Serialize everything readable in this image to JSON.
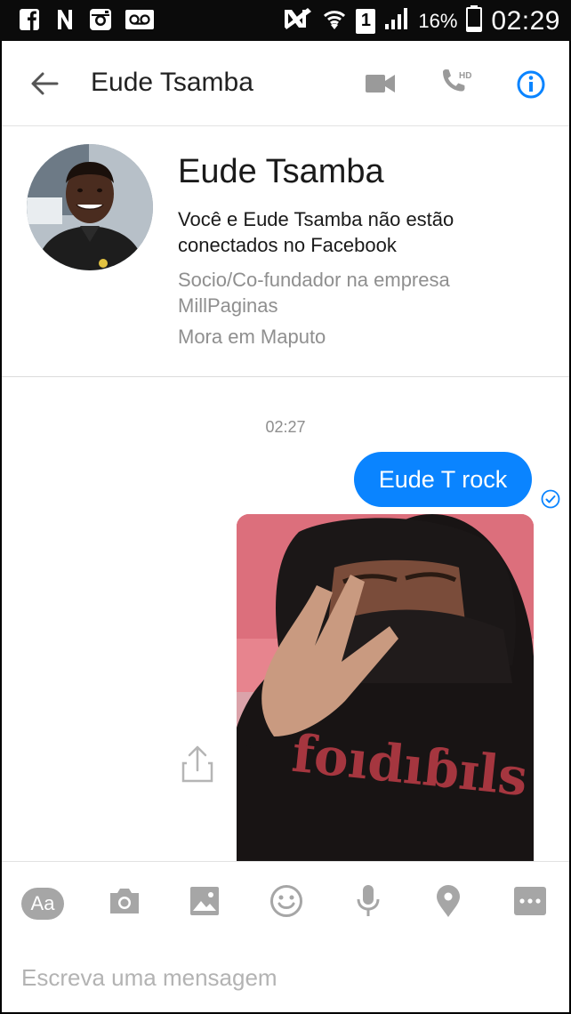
{
  "status_bar": {
    "icons_left": [
      "facebook-icon",
      "n-notification-icon",
      "instagram-icon",
      "voicemail-icon"
    ],
    "icons_right": [
      "nfc-icon",
      "wifi-icon",
      "sim-1-icon",
      "signal-icon",
      "battery-icon"
    ],
    "sim_label": "1",
    "battery_percent": "16%",
    "time": "02:29"
  },
  "toolbar": {
    "title": "Eude Tsamba",
    "call_hd_label": "HD",
    "accent_color": "#0a84ff"
  },
  "profile": {
    "name": "Eude Tsamba",
    "connection_note": "Você e Eude Tsamba não estão conectados no Facebook",
    "work": "Socio/Co-fundador na empresa MillPaginas",
    "location": "Mora em Maputo"
  },
  "conversation": {
    "timestamp": "02:27",
    "messages": [
      {
        "type": "text",
        "text": "Eude T rock",
        "sender": "me",
        "status": "seen"
      },
      {
        "type": "photo",
        "sender": "me"
      }
    ]
  },
  "composer": {
    "icons": [
      "text-style-icon",
      "camera-icon",
      "gallery-icon",
      "emoji-icon",
      "microphone-icon",
      "location-icon",
      "more-icon"
    ],
    "aa_label": "Aa",
    "placeholder": "Escreva uma mensagem"
  }
}
